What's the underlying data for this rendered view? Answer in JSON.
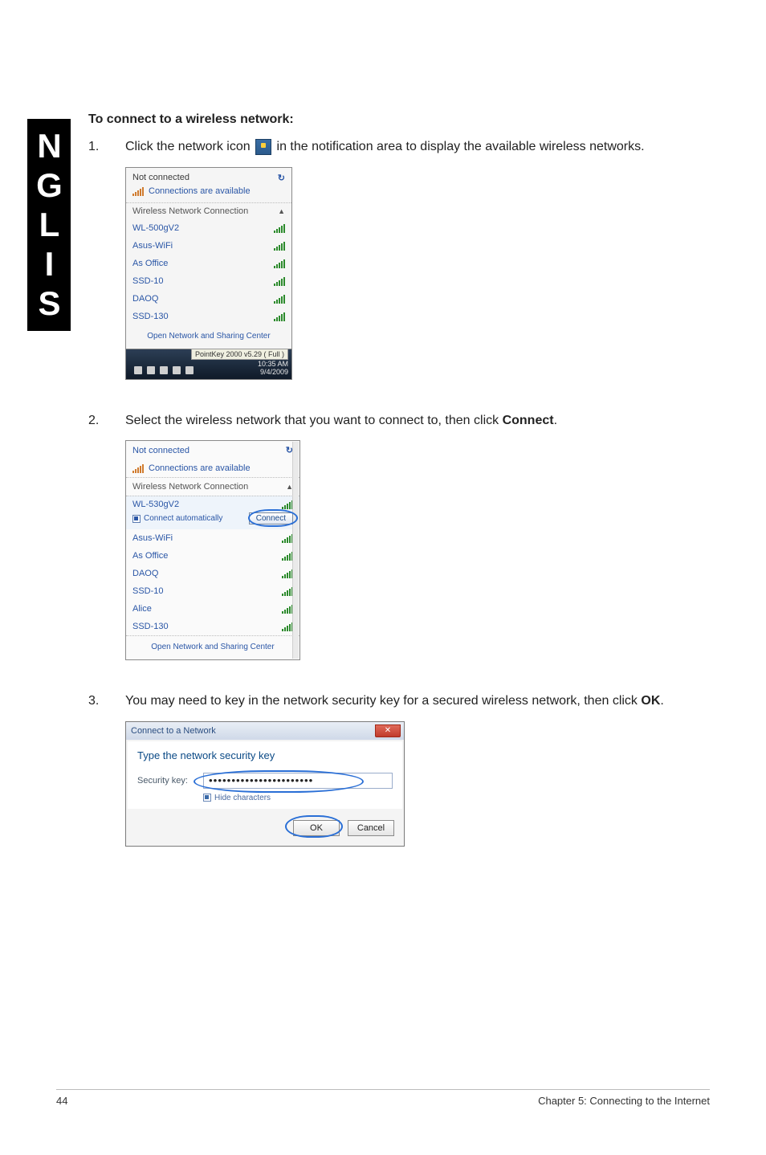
{
  "sidebar_label": "ENGLISH",
  "heading": "To connect to a wireless network:",
  "step1_pre": "Click the network icon ",
  "step1_post": " in the notification area to display the available wireless networks.",
  "step1_num": "1.",
  "step2_num": "2.",
  "step2_text_a": "Select the wireless network that you want to connect to, then click ",
  "step2_text_b": "Connect",
  "step2_text_c": ".",
  "step3_num": "3.",
  "step3_text_a": "You may need to key in the network security key for a secured wireless network, then click ",
  "step3_text_b": "OK",
  "step3_text_c": ".",
  "page_number": "44",
  "footer_chapter": "Chapter 5: Connecting to the Internet",
  "shot1": {
    "not_connected": "Not connected",
    "available": "Connections are available",
    "wireless_header": "Wireless Network Connection",
    "networks": [
      "WL-500gV2",
      "Asus-WiFi",
      "As Office",
      "SSD-10",
      "DAOQ",
      "SSD-130"
    ],
    "footer_link": "Open Network and Sharing Center",
    "tooltip": "PointKey 2000 v5.29 ( Full )",
    "clock_time": "10:35 AM",
    "clock_date": "9/4/2009"
  },
  "shot2": {
    "not_connected": "Not connected",
    "available": "Connections are available",
    "wireless_header": "Wireless Network Connection",
    "selected": "WL-530gV2",
    "auto_label": "Connect automatically",
    "connect_label": "Connect",
    "networks_after": [
      "Asus-WiFi",
      "As Office",
      "DAOQ",
      "SSD-10",
      "Alice",
      "SSD-130"
    ],
    "footer_link": "Open Network and Sharing Center"
  },
  "shot3": {
    "title": "Connect to a Network",
    "heading": "Type the network security key",
    "key_label": "Security key:",
    "key_value": "•••••••••••••••••••••••",
    "hide_label": "Hide characters",
    "ok": "OK",
    "cancel": "Cancel"
  }
}
